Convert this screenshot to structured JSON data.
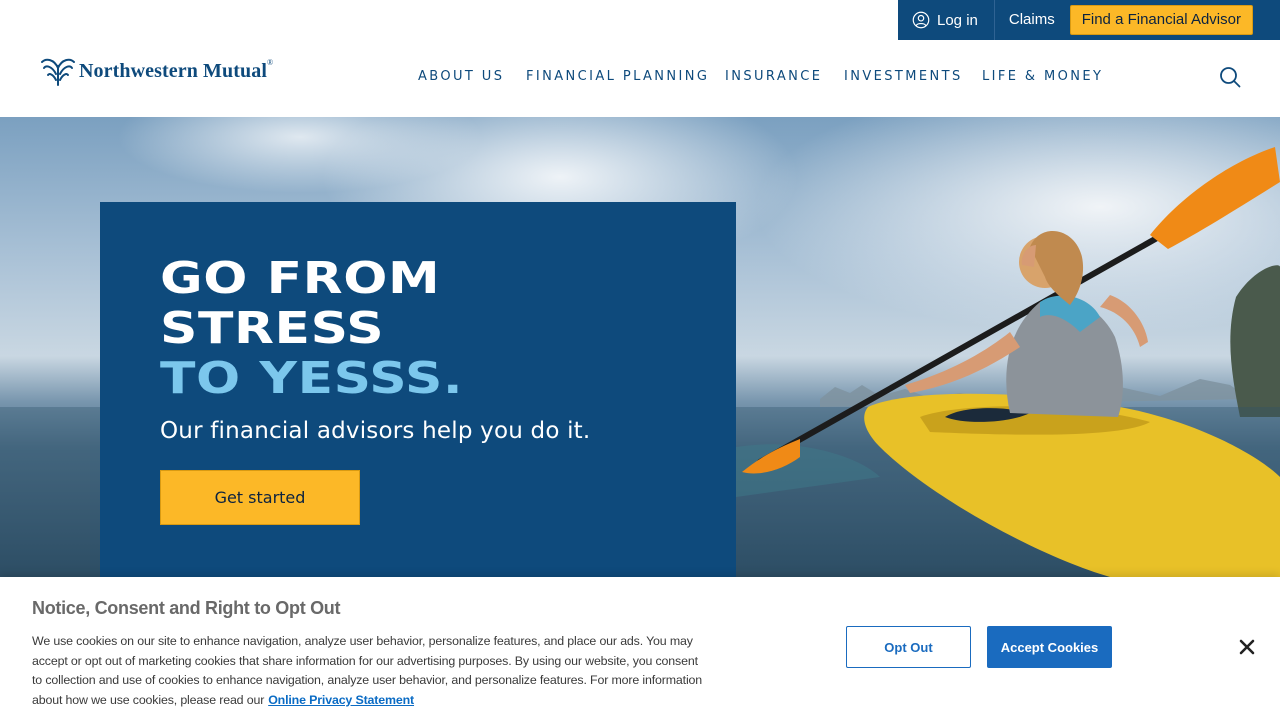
{
  "utility": {
    "login_label": "Log in",
    "claims_label": "Claims",
    "advisor_label": "Find a Financial Advisor"
  },
  "brand": {
    "name": "Northwestern Mutual",
    "mark": "®"
  },
  "nav": {
    "items": [
      "ABOUT US",
      "FINANCIAL PLANNING",
      "INSURANCE",
      "INVESTMENTS",
      "LIFE & MONEY"
    ]
  },
  "hero": {
    "title_line1": "GO FROM",
    "title_line2": "STRESS",
    "title_line3": "TO YESSS.",
    "subtitle": "Our financial advisors help you do it.",
    "cta_label": "Get started"
  },
  "cookie": {
    "title": "Notice, Consent and Right to Opt Out",
    "body": "We use cookies on our site to enhance navigation, analyze user behavior, personalize features, and place our ads. You may accept or opt out of marketing cookies that share information for our advertising purposes. By using our website, you consent to collection and use of cookies to enhance navigation, analyze user behavior, and personalize features. For more information about how we use cookies, please read our",
    "link_label": "Online Privacy Statement",
    "opt_out_label": "Opt Out",
    "accept_label": "Accept Cookies"
  },
  "colors": {
    "brand_navy": "#0e4a7c",
    "cta_gold": "#fcb827",
    "title_accent": "#7cc7ec",
    "cookie_blue": "#1a6bbf"
  },
  "icons": [
    "user-icon",
    "search-icon",
    "close-icon",
    "logo-fountain-icon"
  ]
}
